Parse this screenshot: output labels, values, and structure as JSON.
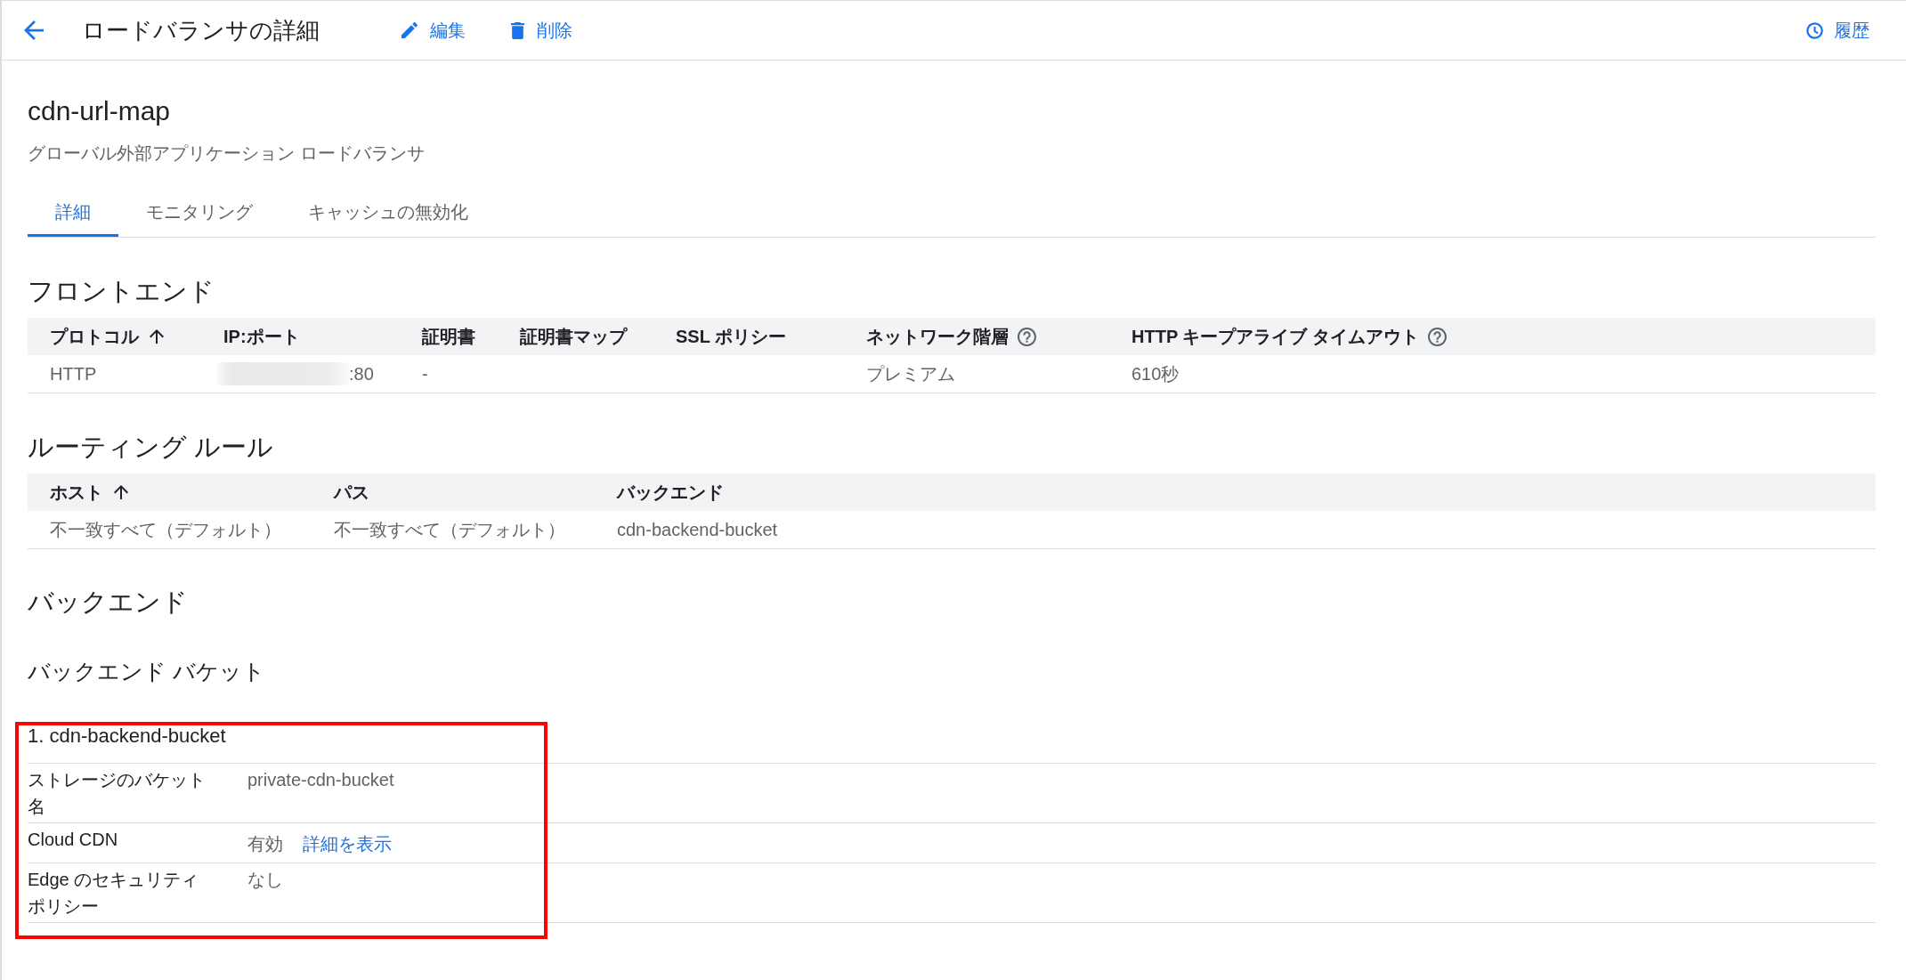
{
  "header": {
    "title": "ロードバランサの詳細",
    "actions": [
      {
        "kind": "edit",
        "label": "編集"
      },
      {
        "kind": "delete",
        "label": "削除"
      }
    ],
    "history": {
      "label": "履歴"
    }
  },
  "load_balancer": {
    "name": "cdn-url-map",
    "type": "グローバル外部アプリケーション ロードバランサ"
  },
  "tabs": [
    {
      "label": "詳細",
      "selected": true
    },
    {
      "label": "モニタリング",
      "selected": false
    },
    {
      "label": "キャッシュの無効化",
      "selected": false
    }
  ],
  "frontend": {
    "title": "フロントエンド",
    "columns": [
      {
        "label": "プロトコル",
        "sorted": true,
        "help": false
      },
      {
        "label": "IP:ポート",
        "sorted": false,
        "help": false
      },
      {
        "label": "証明書",
        "sorted": false,
        "help": false
      },
      {
        "label": "証明書マップ",
        "sorted": false,
        "help": false
      },
      {
        "label": "SSL ポリシー",
        "sorted": false,
        "help": false
      },
      {
        "label": "ネットワーク階層",
        "sorted": false,
        "help": true
      },
      {
        "label": "HTTP キープアライブ タイムアウト",
        "sorted": false,
        "help": true
      }
    ],
    "rows": [
      {
        "cells": [
          {
            "text": "HTTP",
            "redacted": false
          },
          {
            "text": ":80",
            "redacted": true
          },
          {
            "text": "-",
            "redacted": false
          },
          null,
          null,
          {
            "text": "プレミアム",
            "redacted": false
          },
          {
            "text": "610秒",
            "redacted": false
          }
        ]
      }
    ]
  },
  "routing_rules": {
    "title": "ルーティング ルール",
    "columns": [
      {
        "label": "ホスト",
        "sorted": true
      },
      {
        "label": "パス",
        "sorted": false
      },
      {
        "label": "バックエンド",
        "sorted": false
      }
    ],
    "rows": [
      {
        "cells": [
          "不一致すべて（デフォルト）",
          "不一致すべて（デフォルト）",
          "cdn-backend-bucket"
        ]
      }
    ]
  },
  "backend": {
    "title": "バックエンド",
    "subtitle": "バックエンド バケット",
    "buckets": [
      {
        "title": "1. cdn-backend-bucket",
        "highlighted": true,
        "fields": [
          {
            "label": "ストレージのバケット名",
            "value": "private-cdn-bucket"
          },
          {
            "label": "Cloud CDN",
            "value": "有効",
            "link": "詳細を表示"
          },
          {
            "label": "Edge のセキュリティポリシー",
            "value": "なし"
          }
        ]
      }
    ]
  }
}
